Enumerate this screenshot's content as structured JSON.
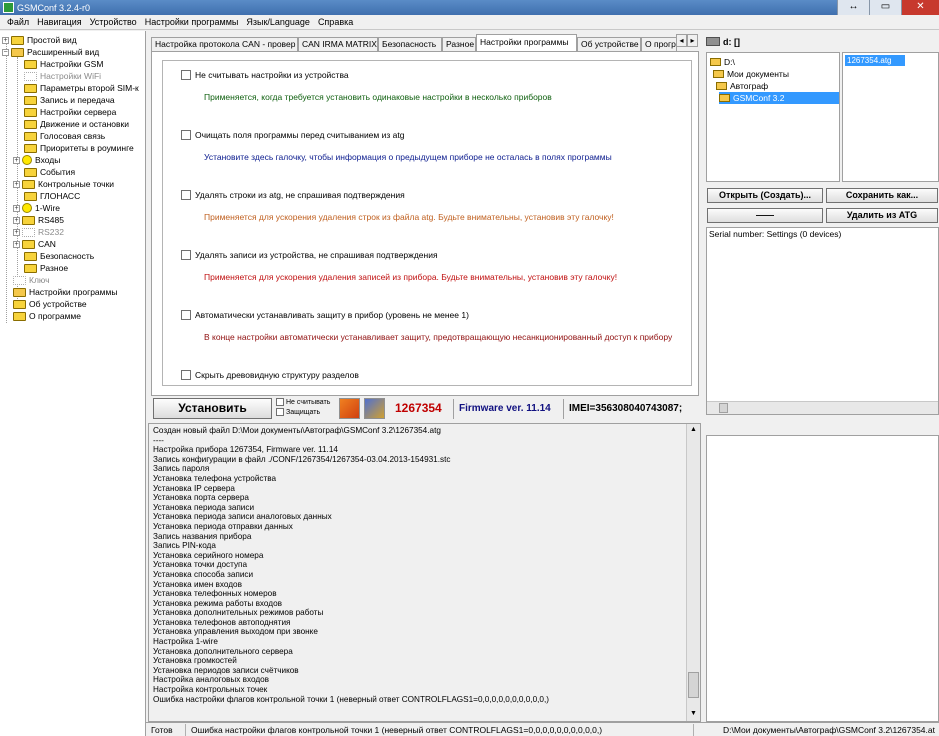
{
  "window": {
    "title": "GSMConf 3.2.4-r0",
    "controls": {
      "restore": "↔",
      "minimize": "▭",
      "close": "✕"
    }
  },
  "menu": [
    "Файл",
    "Навигация",
    "Устройство",
    "Настройки программы",
    "Язык/Language",
    "Справка"
  ],
  "tree": {
    "items": [
      {
        "label": "Простой вид",
        "pm": "+"
      },
      {
        "label": "Расширенный вид",
        "pm": "−"
      },
      {
        "label": "Настройки GSM"
      },
      {
        "label": "Настройки WiFi",
        "dim": true
      },
      {
        "label": "Параметры второй SIM-к"
      },
      {
        "label": "Запись и передача"
      },
      {
        "label": "Настройки сервера"
      },
      {
        "label": "Движение и остановки"
      },
      {
        "label": "Голосовая связь"
      },
      {
        "label": "Приоритеты в роуминге"
      },
      {
        "label": "Входы",
        "pm": "+"
      },
      {
        "label": "События"
      },
      {
        "label": "Контрольные точки",
        "pm": "+"
      },
      {
        "label": "ГЛОНАСС"
      },
      {
        "label": "1-Wire",
        "pm": "+"
      },
      {
        "label": "RS485",
        "pm": "+"
      },
      {
        "label": "RS232",
        "pm": "+",
        "dim": true
      },
      {
        "label": "CAN",
        "pm": "+"
      },
      {
        "label": "Безопасность"
      },
      {
        "label": "Разное"
      },
      {
        "label": "Ключ",
        "dim": true
      },
      {
        "label": "Настройки программы"
      },
      {
        "label": "Об устройстве"
      },
      {
        "label": "О программе"
      }
    ]
  },
  "tabs": [
    "Настройка протокола CAN - провер",
    "CAN IRMA MATRIX",
    "Безопасность",
    "Разное",
    "Настройки программы",
    "Об устройстве",
    "О прогр"
  ],
  "tab_arrows": [
    "◂",
    "▸"
  ],
  "settings": {
    "options": [
      {
        "label": "Не считывать настройки из устройства",
        "desc": "Применяется, когда требуется установить одинаковые настройки в несколько приборов"
      },
      {
        "label": "Очищать поля программы перед считыванием из atg",
        "desc": "Установите здесь галочку, чтобы информация о предыдущем приборе не осталась в полях программы"
      },
      {
        "label": "Удалять строки из atg, не спрашивая подтверждения",
        "desc": "Применяется для ускорения удаления строк из файла atg. Будьте внимательны, установив эту галочку!"
      },
      {
        "label": "Удалять записи из устройства, не спрашивая подтверждения",
        "desc": "Применяется для ускорения удаления записей из прибора. Будьте внимательны, установив эту галочку!"
      },
      {
        "label": "Автоматически устанавливать защиту в прибор (уровень не менее 1)",
        "desc": "В конце настройки автоматически устанавливает защиту, предотвращающую несанкционированный доступ к прибору"
      },
      {
        "label": "Скрыть древовидную структуру разделов",
        "desc": ""
      }
    ]
  },
  "actions": {
    "install_label": "Установить",
    "no_read_label": "Не считывать",
    "protect_label": "Защищать",
    "device_id": "1267354",
    "firmware": "Firmware ver. 11.14",
    "imei": "IMEI=356308040743087;"
  },
  "log": {
    "lines": [
      "Создан новый файл D:\\Мои документы\\Автограф\\GSMConf 3.2\\1267354.atg",
      "----",
      "Настройка прибора 1267354, Firmware ver. 11.14",
      "Запись конфигурации в файл ./CONF/1267354/1267354-03.04.2013-154931.stc",
      "Запись пароля",
      "Установка телефона устройства",
      "Установка IP сервера",
      "Установка порта сервера",
      "Установка периода записи",
      "Установка периода записи аналоговых данных",
      "Установка периода отправки данных",
      "Запись названия прибора",
      "Запись PIN-кода",
      "Установка серийного номера",
      "Установка точки доступа",
      "Установка способа записи",
      "Установка имен входов",
      "Установка телефонных номеров",
      "Установка режима работы входов",
      "Установка дополнительных режимов работы",
      "Установка телефонов автоподнятия",
      "Установка управления выходом при звонке",
      "Настройка 1-wire",
      "Установка дополнительного сервера",
      "Установка громкостей",
      "Установка периодов записи счётчиков",
      "Настройка аналоговых входов",
      "Настройка контрольных точек",
      "Ошибка настройки флагов контрольной точки 1 (неверный ответ CONTROLFLAGS1=0,0,0,0,0,0,0,0,0,0,)"
    ]
  },
  "status": {
    "state": "Готов",
    "message": "Ошибка настройки флагов контрольной точки 1 (неверный ответ CONTROLFLAGS1=0,0,0,0,0,0,0,0,0,0,)",
    "path": "D:\\Мои документы\\Автограф\\GSMConf 3.2\\1267354.at"
  },
  "right": {
    "drive": "d: []",
    "dirs": [
      "D:\\",
      "Мои документы",
      "Автограф",
      "GSMConf 3.2"
    ],
    "selected_file": "1267354.atg",
    "open_btn": "Открыть (Создать)...",
    "save_btn": "Сохранить как...",
    "dash_btn": "——",
    "delete_btn": "Удалить из ATG",
    "serial_text": "Serial number: Settings (0 devices)"
  }
}
